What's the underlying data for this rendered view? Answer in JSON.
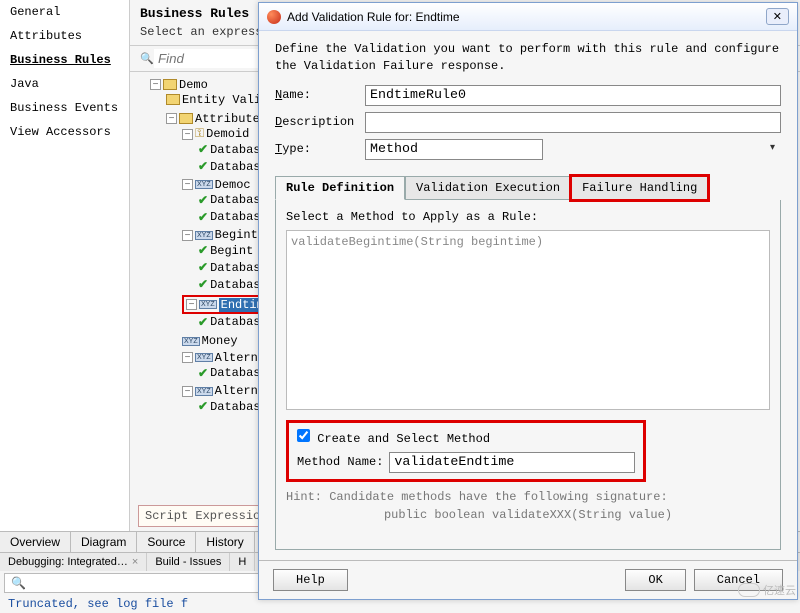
{
  "left_items": [
    "General",
    "Attributes",
    "Business Rules",
    "Java",
    "Business Events",
    "View Accessors"
  ],
  "left_active_index": 2,
  "main": {
    "title": "Business Rules",
    "subtitle": "Select an expression",
    "find_placeholder": "Find"
  },
  "tree": {
    "root": "Demo",
    "entity_validat": "Entity Validat",
    "attributes": "Attributes",
    "demoid": "Demoid",
    "database": "Databas",
    "democ": "Democ",
    "begintime": "Begintime",
    "begint": "Begint",
    "endtime": "Endtime",
    "money": "Money",
    "alternatek": "Alternatek"
  },
  "script_box": "Script Expression",
  "bottom_tabs": [
    "Overview",
    "Diagram",
    "Source",
    "History"
  ],
  "status_chips": [
    "Debugging: Integrated…",
    "Build - Issues",
    "H"
  ],
  "truncated": "Truncated, see log file f",
  "dialog": {
    "title": "Add Validation Rule for: Endtime",
    "desc": "Define the Validation you want to perform with this rule and configure the Validation Failure response.",
    "labels": {
      "name": "Name:",
      "description": "Description",
      "type": "Type:"
    },
    "name_value": "EndtimeRule0",
    "description_value": "",
    "type_value": "Method",
    "tabs": [
      "Rule Definition",
      "Validation Execution",
      "Failure Handling"
    ],
    "tab_active": 0,
    "tab_highlight": 2,
    "method_label": "Select a Method to Apply as a Rule:",
    "method_list": "validateBegintime(String begintime)",
    "create_checked": true,
    "create_label": "Create and Select Method",
    "method_name_label": "Method Name:",
    "method_name_value": "validateEndtime",
    "hint": "Hint: Candidate methods have the following signature:",
    "hint_sig": "public boolean validateXXX(String value)",
    "buttons": {
      "help": "Help",
      "ok": "OK",
      "cancel": "Cancel"
    }
  },
  "watermark": "亿速云"
}
